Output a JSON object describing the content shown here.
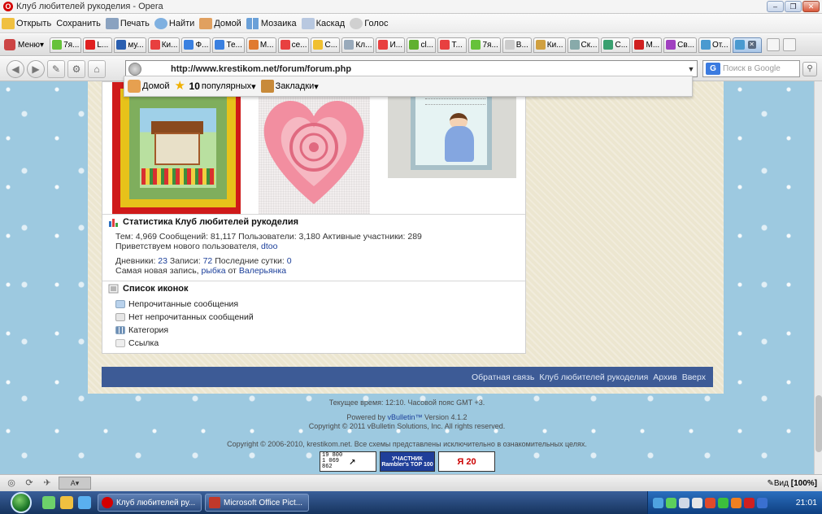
{
  "window": {
    "title": "Клуб любителей рукоделия - Opera"
  },
  "toolbar": {
    "items": [
      {
        "label": "Открыть",
        "icon": "folder-icon"
      },
      {
        "label": "Сохранить",
        "icon": "save-icon"
      },
      {
        "label": "Печать",
        "icon": "print-icon"
      },
      {
        "label": "Найти",
        "icon": "find-icon"
      },
      {
        "label": "Домой",
        "icon": "home-icon"
      },
      {
        "label": "Мозаика",
        "icon": "tile-icon"
      },
      {
        "label": "Каскад",
        "icon": "cascade-icon"
      },
      {
        "label": "Голос",
        "icon": "voice-icon"
      }
    ]
  },
  "tabs": {
    "menu_label": "Меню",
    "items": [
      "7я...",
      "L...",
      "му...",
      "Ки...",
      "Ф...",
      "Те...",
      "М...",
      "се...",
      "С...",
      "Кл...",
      "И...",
      "cl...",
      "Т...",
      "7я...",
      "В...",
      "Ки...",
      "Ск...",
      "С...",
      "М...",
      "Св...",
      "От..."
    ]
  },
  "address": {
    "url": "http://www.krestikom.net/forum/forum.php",
    "search_placeholder": "Поиск в Google"
  },
  "bookmarks_bar": {
    "home": "Домой",
    "popular_count": "10",
    "popular": "популярных",
    "bookmarks": "Закладки"
  },
  "stats": {
    "title": "Статистика Клуб любителей рукоделия",
    "line1": "Тем: 4,969  Сообщений: 81,117  Пользователи: 3,180  Активные участники: 289",
    "welcome_prefix": "Приветствуем нового пользователя,",
    "new_user": "dtoo",
    "diaries_label": "Дневники:",
    "diaries": "23",
    "records_label": "Записи:",
    "records": "72",
    "last_day_label": "Последние сутки:",
    "last_day": "0",
    "newest_prefix": "Самая новая запись,",
    "newest_entry": "рыбка",
    "from": "от",
    "newest_author": "Валерьянка"
  },
  "icons_legend": {
    "title": "Список иконок",
    "items": [
      "Непрочитанные сообщения",
      "Нет непрочитанных сообщений",
      "Категория",
      "Ссылка"
    ]
  },
  "footer_links": [
    "Обратная связь",
    "Клуб любителей рукоделия",
    "Архив",
    "Вверх"
  ],
  "footer": {
    "time": "Текущее время: 12:10. Часовой пояс GMT +3.",
    "powered_prefix": "Powered by",
    "powered_brand": "vBulletin™",
    "powered_suffix": "Version 4.1.2",
    "copyright_vb": "Copyright © 2011 vBulletin Solutions, Inc. All rights reserved.",
    "copyright_site": "Copyright © 2006-2010, krestikom.net. Все схемы представлены исключительно в ознакомительных целях.",
    "counter1": "19 800\n1 069\n862",
    "rambler_line1": "УЧАСТНИК",
    "rambler_line2": "Rambler's TOP 100",
    "yandex": "Я 20"
  },
  "statusbar": {
    "zoom_label": "Вид",
    "zoom_value": "[100%]",
    "a_label": "A"
  },
  "taskbar": {
    "tasks": [
      "Клуб любителей ру...",
      "Microsoft Office Pict..."
    ],
    "clock": "21:01"
  }
}
